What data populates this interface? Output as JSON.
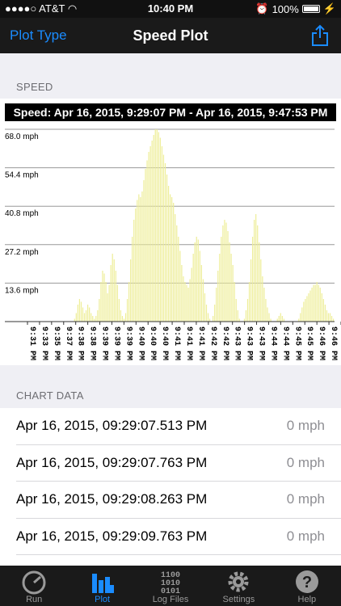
{
  "status": {
    "carrier": "AT&T",
    "time": "10:40 PM",
    "battery": "100%"
  },
  "nav": {
    "back_label": "Plot Type",
    "title": "Speed Plot"
  },
  "chart_section_title": "SPEED",
  "chart_data": {
    "type": "area",
    "title": "Speed: Apr 16, 2015, 9:29:07 PM - Apr 16, 2015, 9:47:53 PM",
    "ylabel": "",
    "xlabel": "",
    "yticks": [
      "68.0 mph",
      "54.4 mph",
      "40.8 mph",
      "27.2 mph",
      "13.6 mph"
    ],
    "ylim": [
      0,
      68.0
    ],
    "xticks": [
      "9:31 PM",
      "9:33 PM",
      "9:35 PM",
      "9:37 PM",
      "9:38 PM",
      "9:38 PM",
      "9:39 PM",
      "9:39 PM",
      "9:39 PM",
      "9:40 PM",
      "9:40 PM",
      "9:40 PM",
      "9:41 PM",
      "9:41 PM",
      "9:41 PM",
      "9:42 PM",
      "9:42 PM",
      "9:43 PM",
      "9:43 PM",
      "9:43 PM",
      "9:44 PM",
      "9:44 PM",
      "9:45 PM",
      "9:45 PM",
      "9:46 PM",
      "9:46 PM",
      "9:46 PM"
    ],
    "series": [
      {
        "color": "#eeee99",
        "values": [
          0,
          0,
          0,
          0,
          0,
          0,
          0,
          0,
          0,
          0,
          0,
          0,
          0,
          0,
          0,
          0,
          0,
          0,
          0,
          0,
          0,
          0,
          0,
          0,
          0,
          0,
          0,
          0,
          0,
          0,
          0,
          0,
          0,
          0,
          0,
          0,
          0,
          0,
          0,
          0,
          0,
          0,
          1,
          3,
          6,
          8,
          7,
          5,
          3,
          4,
          6,
          5,
          3,
          2,
          1,
          2,
          4,
          8,
          14,
          18,
          17,
          14,
          10,
          13,
          20,
          24,
          22,
          18,
          13,
          8,
          4,
          2,
          1,
          3,
          8,
          14,
          22,
          30,
          36,
          40,
          43,
          45,
          44,
          46,
          50,
          54,
          57,
          60,
          62,
          64,
          66,
          68,
          68,
          67,
          65,
          62,
          59,
          56,
          52,
          48,
          45,
          44,
          42,
          38,
          34,
          30,
          25,
          20,
          16,
          14,
          13,
          12,
          15,
          19,
          24,
          28,
          30,
          29,
          25,
          20,
          15,
          10,
          6,
          3,
          1,
          0,
          2,
          6,
          12,
          18,
          24,
          30,
          34,
          36,
          35,
          32,
          28,
          24,
          20,
          14,
          8,
          4,
          1,
          0,
          0,
          1,
          4,
          8,
          14,
          22,
          30,
          36,
          38,
          34,
          28,
          22,
          16,
          12,
          8,
          5,
          3,
          1,
          0,
          0,
          0,
          1,
          2,
          3,
          2,
          1,
          0,
          0,
          0,
          0,
          0,
          0,
          0,
          0,
          1,
          3,
          5,
          7,
          8,
          9,
          10,
          11,
          12,
          13,
          13,
          14,
          13,
          12,
          10,
          8,
          6,
          4,
          3,
          3,
          2,
          1
        ]
      }
    ]
  },
  "list_section_title": "CHART DATA",
  "rows": [
    {
      "time": "Apr 16, 2015, 09:29:07.513 PM",
      "value": "0 mph"
    },
    {
      "time": "Apr 16, 2015, 09:29:07.763 PM",
      "value": "0 mph"
    },
    {
      "time": "Apr 16, 2015, 09:29:08.263 PM",
      "value": "0 mph"
    },
    {
      "time": "Apr 16, 2015, 09:29:09.763 PM",
      "value": "0 mph"
    }
  ],
  "tabs": [
    {
      "label": "Run",
      "icon": "speedometer-icon",
      "active": false
    },
    {
      "label": "Plot",
      "icon": "bar-chart-icon",
      "active": true
    },
    {
      "label": "Log Files",
      "icon": "binary-icon",
      "active": false
    },
    {
      "label": "Settings",
      "icon": "gear-icon",
      "active": false
    },
    {
      "label": "Help",
      "icon": "question-icon",
      "active": false
    }
  ]
}
